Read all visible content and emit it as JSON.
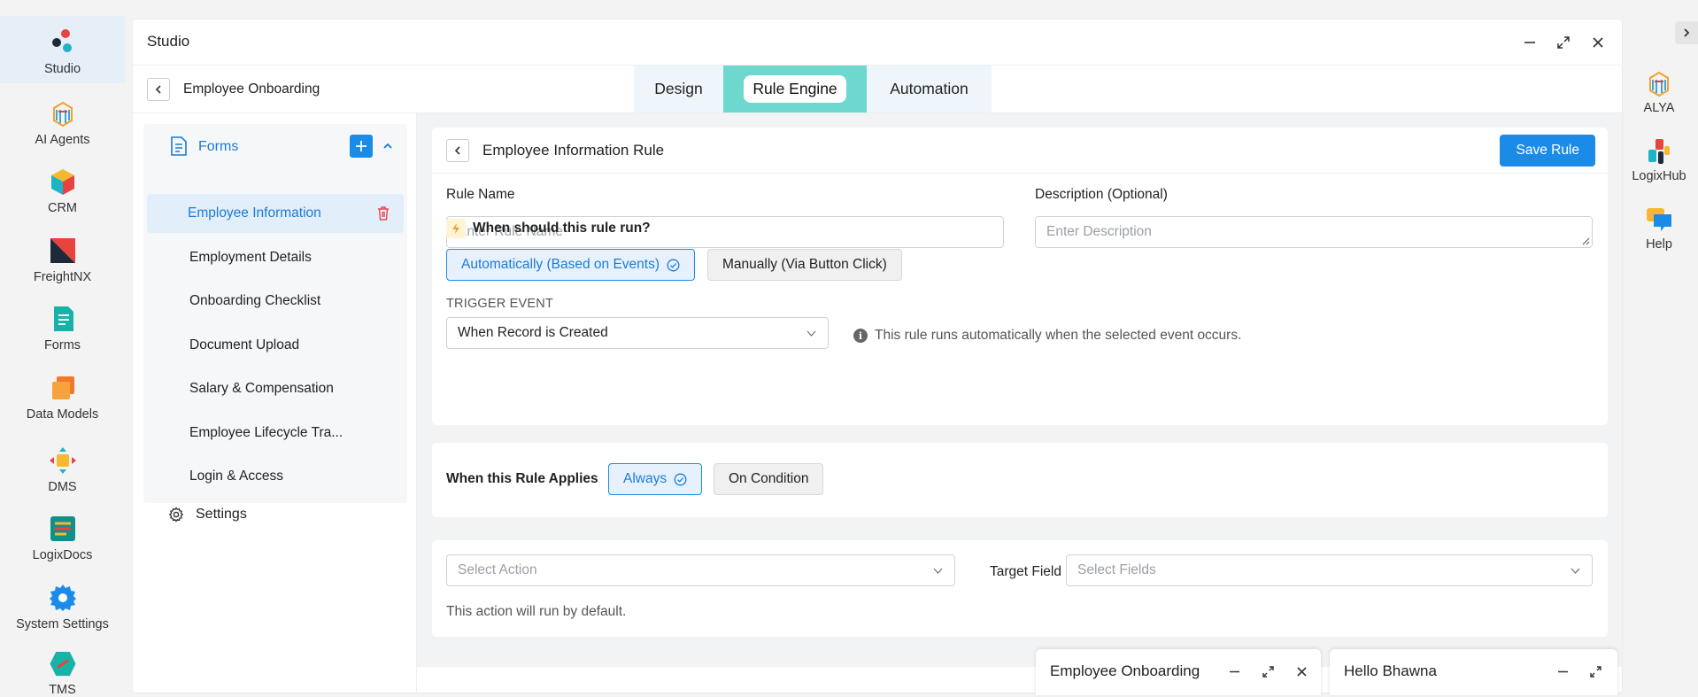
{
  "rail": {
    "items": [
      {
        "label": "Studio",
        "icon": "studio-icon",
        "active": true
      },
      {
        "label": "AI Agents",
        "icon": "ai-agents-icon"
      },
      {
        "label": "CRM",
        "icon": "crm-icon"
      },
      {
        "label": "FreightNX",
        "icon": "freightnx-icon"
      },
      {
        "label": "Forms",
        "icon": "forms-icon"
      },
      {
        "label": "Data Models",
        "icon": "data-models-icon"
      },
      {
        "label": "DMS",
        "icon": "dms-icon"
      },
      {
        "label": "LogixDocs",
        "icon": "logixdocs-icon"
      },
      {
        "label": "System Settings",
        "icon": "system-settings-icon"
      },
      {
        "label": "TMS",
        "icon": "tms-icon"
      }
    ]
  },
  "right_rail": {
    "items": [
      {
        "label": "ALYA",
        "icon": "alya-icon"
      },
      {
        "label": "LogixHub",
        "icon": "logixhub-icon"
      },
      {
        "label": "Help",
        "icon": "help-icon"
      }
    ]
  },
  "window": {
    "title": "Studio",
    "breadcrumb": "Employee Onboarding",
    "tabs": [
      {
        "label": "Design"
      },
      {
        "label": "Rule Engine",
        "active": true
      },
      {
        "label": "Automation"
      }
    ]
  },
  "forms_panel": {
    "header": "Forms",
    "items": [
      {
        "label": "Employee Information",
        "active": true
      },
      {
        "label": "Employment Details"
      },
      {
        "label": "Onboarding Checklist"
      },
      {
        "label": "Document Upload"
      },
      {
        "label": "Salary & Compensation"
      },
      {
        "label": "Employee Lifecycle Tra..."
      },
      {
        "label": "Login & Access"
      }
    ],
    "settings_label": "Settings"
  },
  "rule": {
    "title": "Employee Information Rule",
    "save_label": "Save Rule",
    "rule_name_label": "Rule Name",
    "rule_name_placeholder": "Enter Rule Name",
    "rule_name_value": "",
    "description_label": "Description (Optional)",
    "description_placeholder": "Enter Description",
    "run_question": "When should this rule run?",
    "run_options": [
      {
        "label": "Automatically (Based on Events)",
        "selected": true
      },
      {
        "label": "Manually (Via Button Click)",
        "selected": false
      }
    ],
    "trigger_label": "TRIGGER EVENT",
    "trigger_value": "When Record is Created",
    "trigger_info": "This rule runs automatically when the selected event occurs.",
    "applies_label": "When this Rule Applies",
    "applies_options": [
      {
        "label": "Always",
        "selected": true
      },
      {
        "label": "On Condition",
        "selected": false
      }
    ],
    "action_placeholder": "Select Action",
    "target_field_label": "Target Field",
    "target_field_placeholder": "Select Fields",
    "action_note": "This action will run by default."
  },
  "docks": [
    {
      "title": "Employee Onboarding"
    },
    {
      "title": "Hello Bhawna"
    }
  ],
  "colors": {
    "accent": "#1a8ce8",
    "tab_active": "#6ed8cf",
    "tab_bg": "#eef6fb",
    "danger": "#e5484d"
  }
}
